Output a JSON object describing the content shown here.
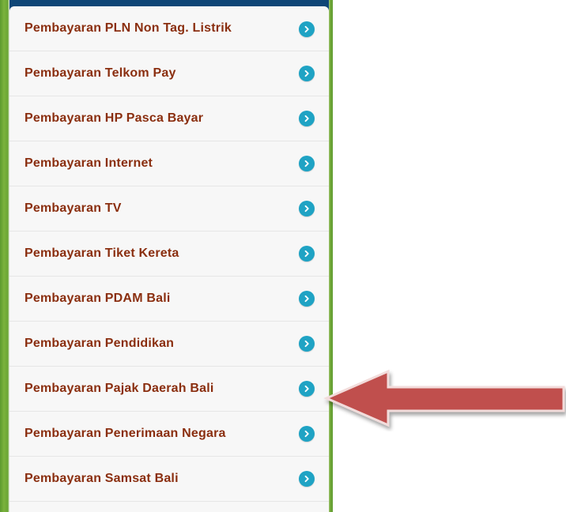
{
  "menu": {
    "items": [
      {
        "label": "Pembayaran PLN Non Tag. Listrik",
        "icon": "chevron-right-circle-icon"
      },
      {
        "label": "Pembayaran Telkom Pay",
        "icon": "chevron-right-circle-icon"
      },
      {
        "label": "Pembayaran HP Pasca Bayar",
        "icon": "chevron-right-circle-icon"
      },
      {
        "label": "Pembayaran Internet",
        "icon": "chevron-right-circle-icon"
      },
      {
        "label": "Pembayaran TV",
        "icon": "chevron-right-circle-icon"
      },
      {
        "label": "Pembayaran Tiket Kereta",
        "icon": "chevron-right-circle-icon"
      },
      {
        "label": "Pembayaran PDAM Bali",
        "icon": "chevron-right-circle-icon"
      },
      {
        "label": "Pembayaran Pendidikan",
        "icon": "chevron-right-circle-icon"
      },
      {
        "label": "Pembayaran Pajak Daerah Bali",
        "icon": "chevron-right-circle-icon"
      },
      {
        "label": "Pembayaran Penerimaan Negara",
        "icon": "chevron-right-circle-icon"
      },
      {
        "label": "Pembayaran Samsat Bali",
        "icon": "chevron-right-circle-icon"
      }
    ]
  },
  "annotation": {
    "icon": "left-arrow-pointer-icon",
    "color": "#c0504d",
    "points_to_item": "Pembayaran Pajak Daerah Bali"
  },
  "colors": {
    "label_text": "#8a2e0f",
    "chevron_circle": "#1fa3c4",
    "header_bar": "#0f4677",
    "side_border": "#6aa534"
  }
}
